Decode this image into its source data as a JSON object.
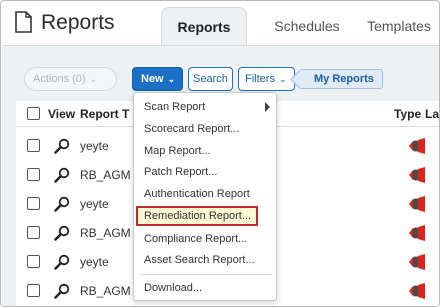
{
  "header": {
    "title": "Reports",
    "tabs": [
      {
        "label": "Reports",
        "active": true
      },
      {
        "label": "Schedules",
        "active": false
      },
      {
        "label": "Templates",
        "active": false
      }
    ]
  },
  "toolbar": {
    "actions_label": "Actions (0)",
    "new_label": "New",
    "search_label": "Search",
    "filters_label": "Filters",
    "filter_tag": "My Reports"
  },
  "table": {
    "columns": [
      "View",
      "Report T",
      "Type",
      "La"
    ],
    "rows": [
      {
        "title": "yeyte"
      },
      {
        "title": "RB_AGM"
      },
      {
        "title": "yeyte"
      },
      {
        "title": "RB_AGM"
      },
      {
        "title": "yeyte"
      },
      {
        "title": "RB_AGM"
      }
    ]
  },
  "menu": {
    "items": [
      {
        "label": "Scan Report",
        "submenu": true
      },
      {
        "label": "Scorecard Report..."
      },
      {
        "label": "Map Report..."
      },
      {
        "label": "Patch Report..."
      },
      {
        "label": "Authentication Report"
      },
      {
        "label": "Remediation Report...",
        "highlighted": true
      },
      {
        "label": "Compliance Report..."
      },
      {
        "label": "Asset Search Report..."
      },
      {
        "label": "Download..."
      }
    ]
  },
  "colors": {
    "primary_button": "#1b6fc4",
    "highlight_border": "#c4262e",
    "highlight_fill": "#fbf8d4",
    "type_icon_red": "#d9261c"
  },
  "icons": {
    "title": "document-icon",
    "view": "magnifier-icon",
    "type": "report-type-icon",
    "submenu": "chevron-right-icon"
  }
}
